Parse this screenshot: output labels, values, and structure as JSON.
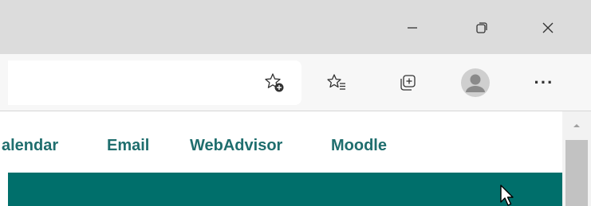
{
  "window_controls": {
    "minimize_icon": "minimize-icon",
    "restore_icon": "restore-icon",
    "close_icon": "close-icon"
  },
  "toolbar": {
    "favorite_add_icon": "star-plus-icon",
    "favorites_icon": "favorites-list-icon",
    "collections_icon": "collections-icon",
    "profile_icon": "profile-avatar-icon",
    "menu_label": "···"
  },
  "nav": {
    "links": [
      "alendar",
      "Email",
      "WebAdvisor",
      "Moodle"
    ]
  },
  "colors": {
    "link": "#1f6e6e",
    "band": "#006f6b",
    "titlebar": "#dcdcdc"
  }
}
